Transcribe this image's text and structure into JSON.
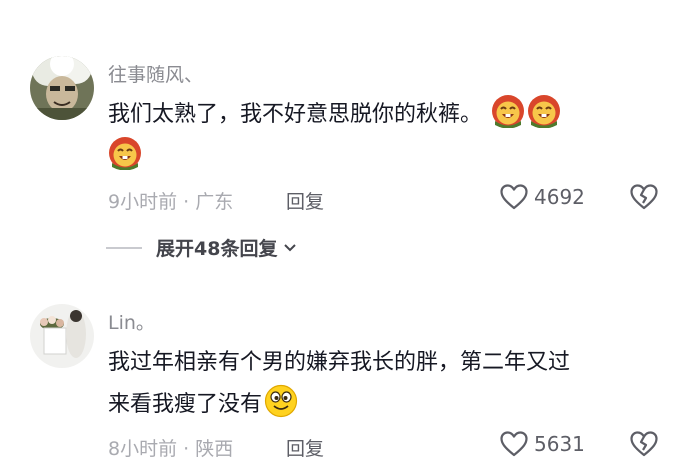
{
  "comments": [
    {
      "username": "往事随风、",
      "text": "我们太熟了，我不好意思脱你的秋裤。",
      "emojis": [
        "laughing-face-icon",
        "laughing-face-icon",
        "laughing-face-icon"
      ],
      "time_location": "9小时前 · 广东",
      "reply_label": "回复",
      "like_count": "4692",
      "expand_label": "展开48条回复"
    },
    {
      "username": "Lin。",
      "text_line1": "我过年相亲有个男的嫌弃我长的胖，第二年又过",
      "text_line2": "来看我瘦了没有",
      "emojis": [
        "grin-face-icon"
      ],
      "time_location": "8小时前 · 陕西",
      "reply_label": "回复",
      "like_count": "5631"
    }
  ]
}
